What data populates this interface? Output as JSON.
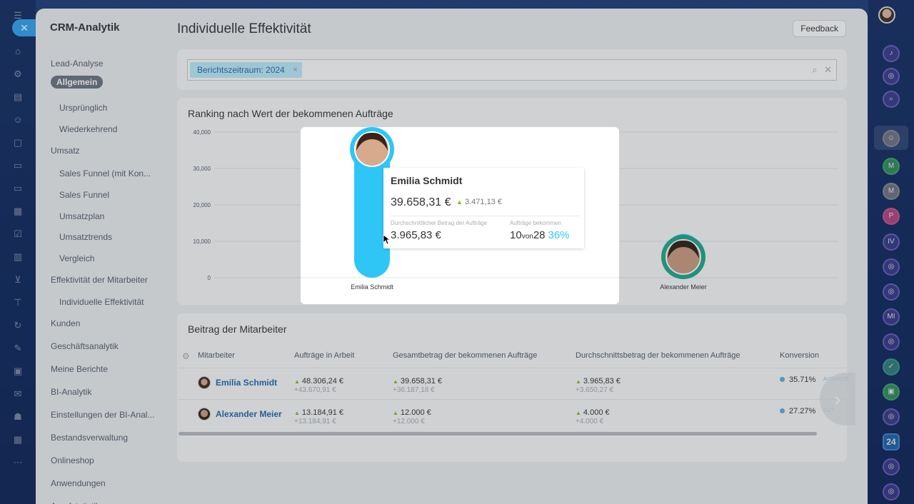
{
  "app": {
    "section_title": "CRM-Analytik",
    "page_title": "Individuelle Effektivität",
    "feedback_label": "Feedback"
  },
  "sidebar": {
    "items": [
      {
        "label": "Lead-Analyse",
        "level": "top"
      },
      {
        "label": "Allgemein",
        "level": "pill"
      },
      {
        "label": "Ursprünglich",
        "level": "sub"
      },
      {
        "label": "Wiederkehrend",
        "level": "sub"
      },
      {
        "label": "Umsatz",
        "level": "top"
      },
      {
        "label": "Sales Funnel (mit Kon...",
        "level": "sub"
      },
      {
        "label": "Sales Funnel",
        "level": "sub"
      },
      {
        "label": "Umsatzplan",
        "level": "sub"
      },
      {
        "label": "Umsatztrends",
        "level": "sub"
      },
      {
        "label": "Vergleich",
        "level": "sub"
      },
      {
        "label": "Effektivität der Mitarbeiter",
        "level": "top"
      },
      {
        "label": "Individuelle Effektivität",
        "level": "sub"
      },
      {
        "label": "Kunden",
        "level": "top"
      },
      {
        "label": "Geschäftsanalytik",
        "level": "top"
      },
      {
        "label": "Meine Berichte",
        "level": "top"
      },
      {
        "label": "BI-Analytik",
        "level": "top"
      },
      {
        "label": "Einstellungen der BI-Anal...",
        "level": "top"
      },
      {
        "label": "Bestandsverwaltung",
        "level": "top"
      },
      {
        "label": "Onlineshop",
        "level": "top"
      },
      {
        "label": "Anwendungen",
        "level": "top"
      },
      {
        "label": "Anrufstatistik",
        "level": "top"
      }
    ]
  },
  "filter": {
    "tag_label": "Berichtszeitraum: 2024",
    "tag_remove": "×",
    "search_icon": "search-icon",
    "clear_icon": "close-icon"
  },
  "ranking": {
    "title": "Ranking nach Wert der bekommenen Aufträge"
  },
  "chart_data": {
    "type": "bar",
    "categories": [
      "Emilia Schmidt",
      "Alexander Meier"
    ],
    "values": [
      39658.31,
      12000
    ],
    "y_ticks": [
      "0",
      "10,000",
      "20,000",
      "30,000",
      "40,000"
    ],
    "ylim": [
      0,
      40000
    ],
    "bar_color": "#2fc6f6",
    "grid": true
  },
  "tooltip": {
    "name": "Emilia Schmidt",
    "amount": "39.658,31 €",
    "delta": "3.471,13 €",
    "avg_label": "Durchschnittlicher Betrag der Aufträge",
    "avg_value": "3.965,83 €",
    "won_label": "Aufträge bekommen",
    "won_count": "10",
    "won_of": "von",
    "won_total": "28",
    "won_pct": "36%"
  },
  "contribution": {
    "title": "Beitrag der Mitarbeiter",
    "settings_icon": "gear-icon",
    "columns": [
      "Mitarbeiter",
      "Aufträge in Arbeit",
      "Gesamtbetrag der bekommenen Aufträge",
      "Durchschnittsbetrag der bekommenen Aufträge",
      "Konversion"
    ],
    "rows": [
      {
        "name": "Emilia Schmidt",
        "in_work": "48.306,24 €",
        "in_work_delta": "+43.670,91 €",
        "total": "39.658,31 €",
        "total_delta": "+36.187,18 €",
        "avg": "3.965,83 €",
        "avg_delta": "+3.650,27 €",
        "conversion": "35.71%",
        "conversion_tag": "AUSGEZE"
      },
      {
        "name": "Alexander Meier",
        "in_work": "13.184,91 €",
        "in_work_delta": "+13.184,91 €",
        "total": "12.000 €",
        "total_delta": "+12.000 €",
        "avg": "4.000 €",
        "avg_delta": "+4.000 €",
        "conversion": "27.27%",
        "conversion_tag": "GUT"
      }
    ]
  },
  "right_bar": {
    "counter_label": "24"
  },
  "colors": {
    "accent": "#2fc6f6",
    "link": "#2067b0",
    "positive": "#7ec11c"
  }
}
